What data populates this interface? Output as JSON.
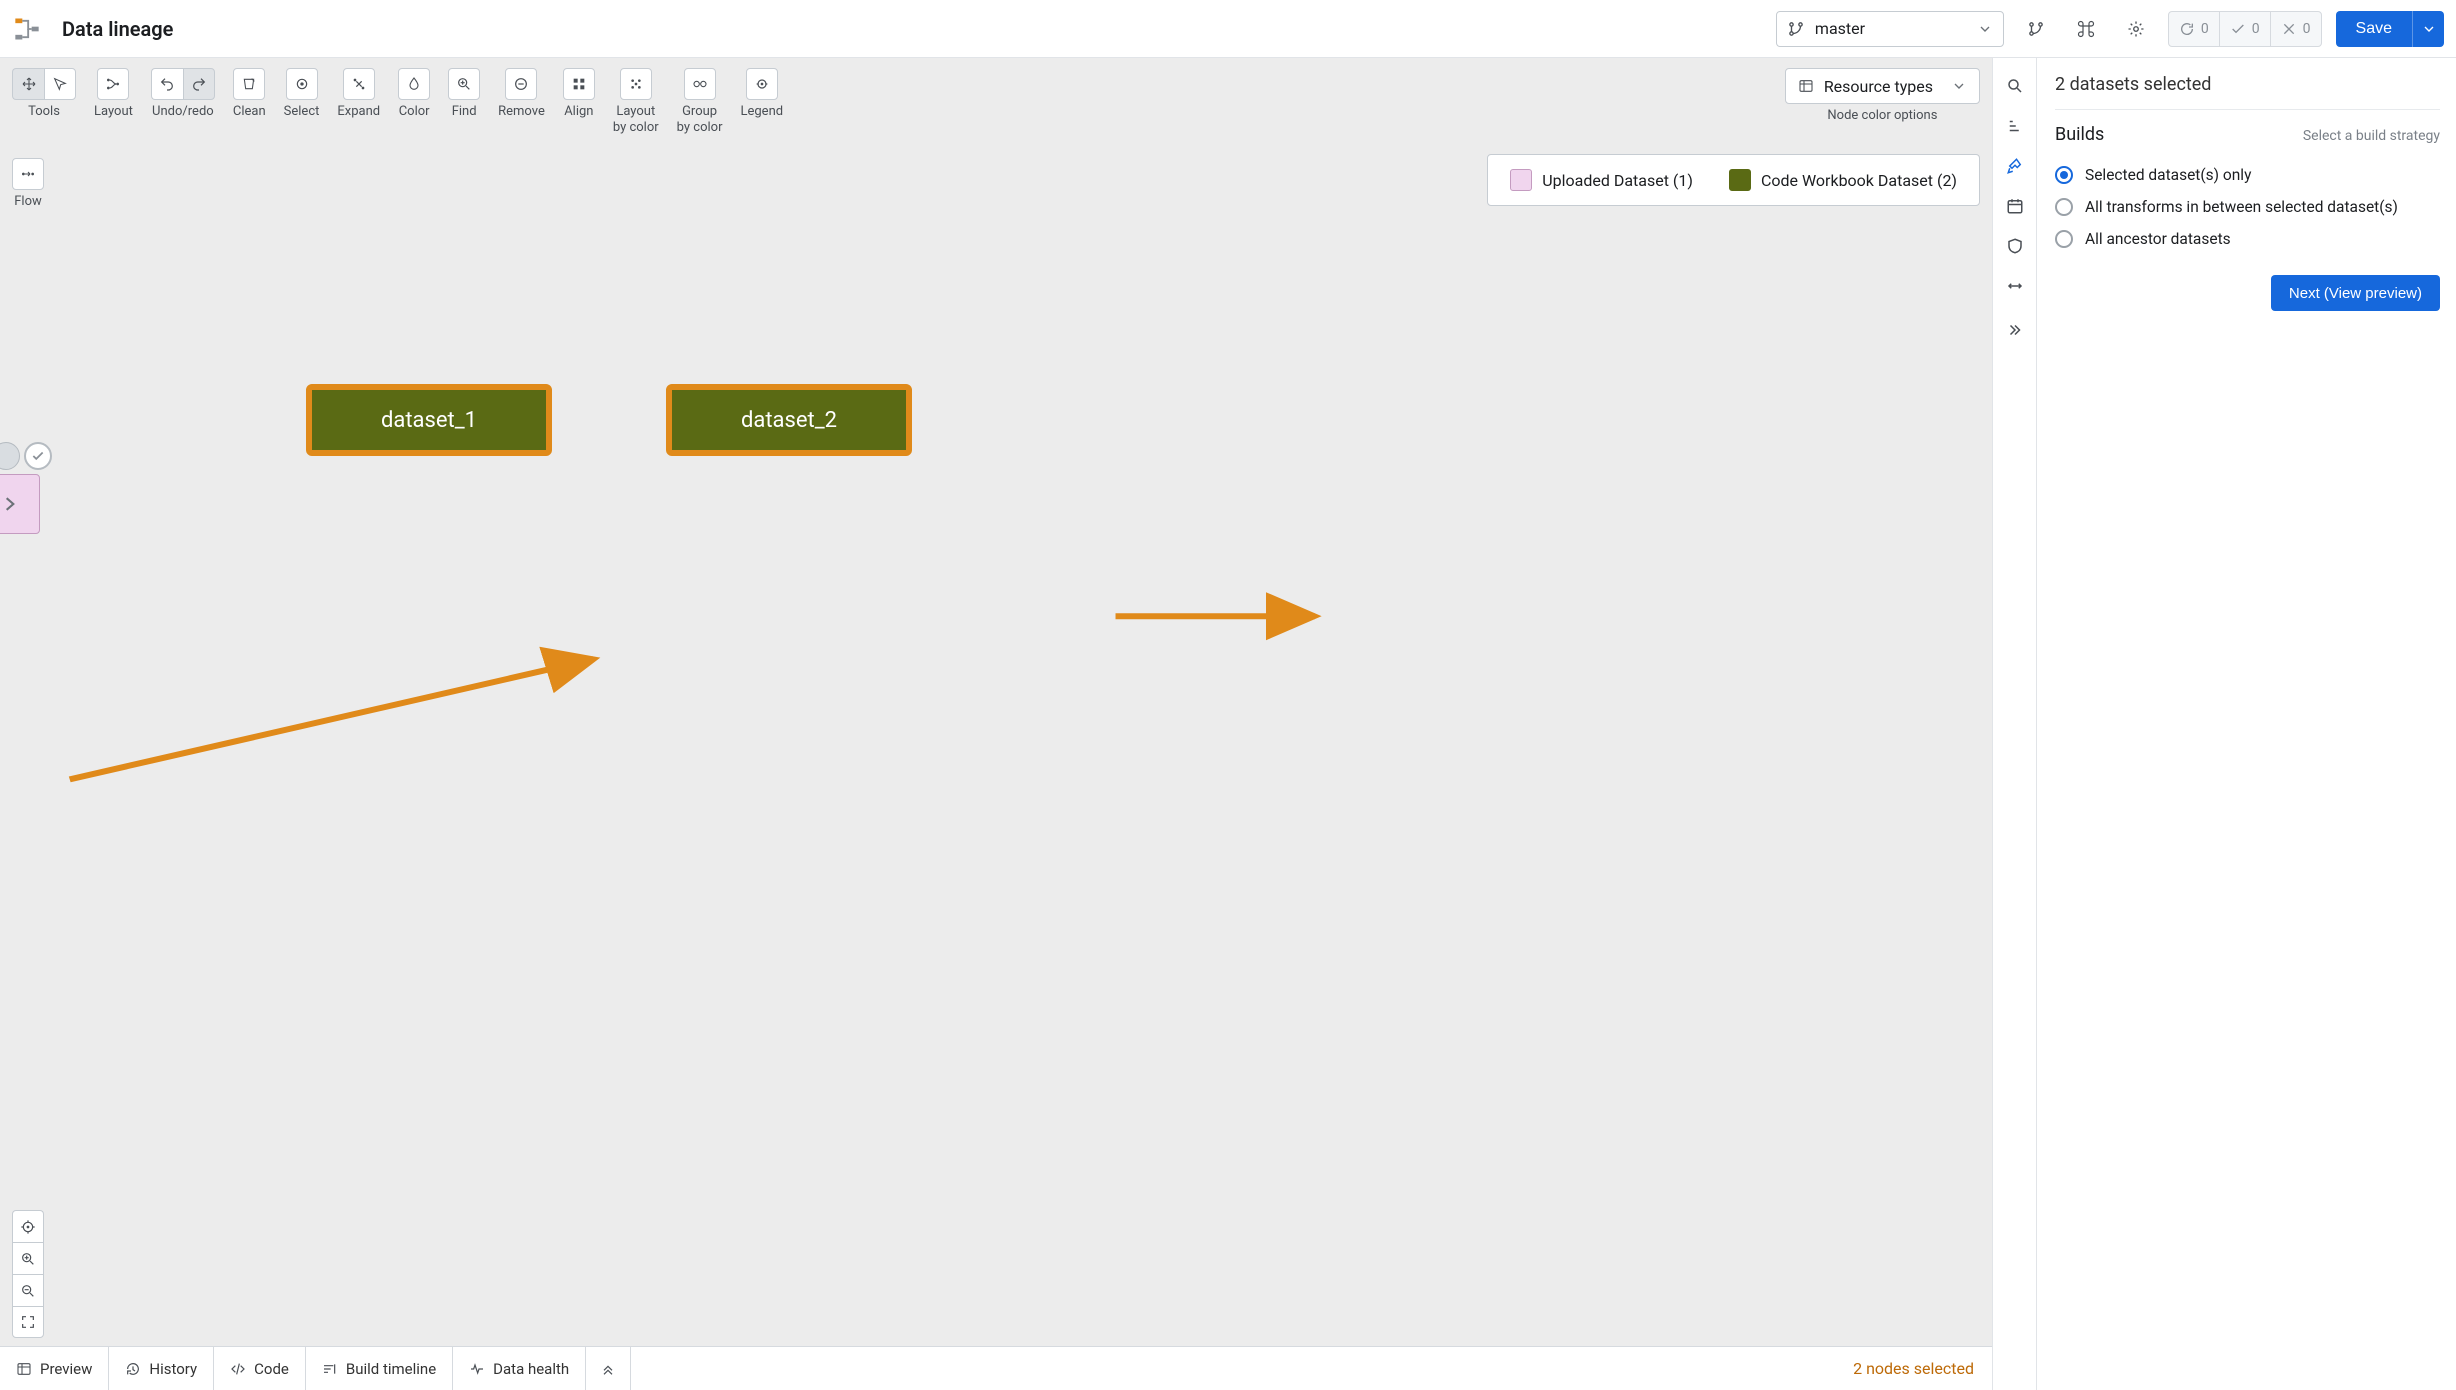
{
  "header": {
    "title": "Data lineage",
    "branch": "master",
    "status": {
      "refresh": 0,
      "ok": 0,
      "cancel": 0
    },
    "save_label": "Save"
  },
  "toolbar": {
    "groups": {
      "tools": "Tools",
      "layout": "Layout",
      "undoredo": "Undo/redo",
      "clean": "Clean",
      "select": "Select",
      "expand": "Expand",
      "color": "Color",
      "find": "Find",
      "remove": "Remove",
      "align": "Align",
      "layout_by_color": "Layout\nby color",
      "group_by_color": "Group\nby color",
      "legend": "Legend",
      "flow": "Flow"
    },
    "resource_types": "Resource types",
    "node_color_options": "Node color options"
  },
  "legend": {
    "uploaded": {
      "label": "Uploaded Dataset (1)",
      "color": "#f0d5ee",
      "border": "#c49bc0"
    },
    "workbook": {
      "label": "Code Workbook Dataset (2)",
      "color": "#5a6a14",
      "border": "#5a6a14"
    }
  },
  "graph": {
    "node1": "dataset_1",
    "node2": "dataset_2"
  },
  "bottom": {
    "preview": "Preview",
    "history": "History",
    "code": "Code",
    "timeline": "Build timeline",
    "health": "Data health",
    "status": "2 nodes selected"
  },
  "panel": {
    "title": "2 datasets selected",
    "section": "Builds",
    "hint": "Select a build strategy",
    "options": {
      "selected_only": "Selected dataset(s) only",
      "between": "All transforms in between selected dataset(s)",
      "ancestors": "All ancestor datasets"
    },
    "next": "Next (View preview)"
  }
}
